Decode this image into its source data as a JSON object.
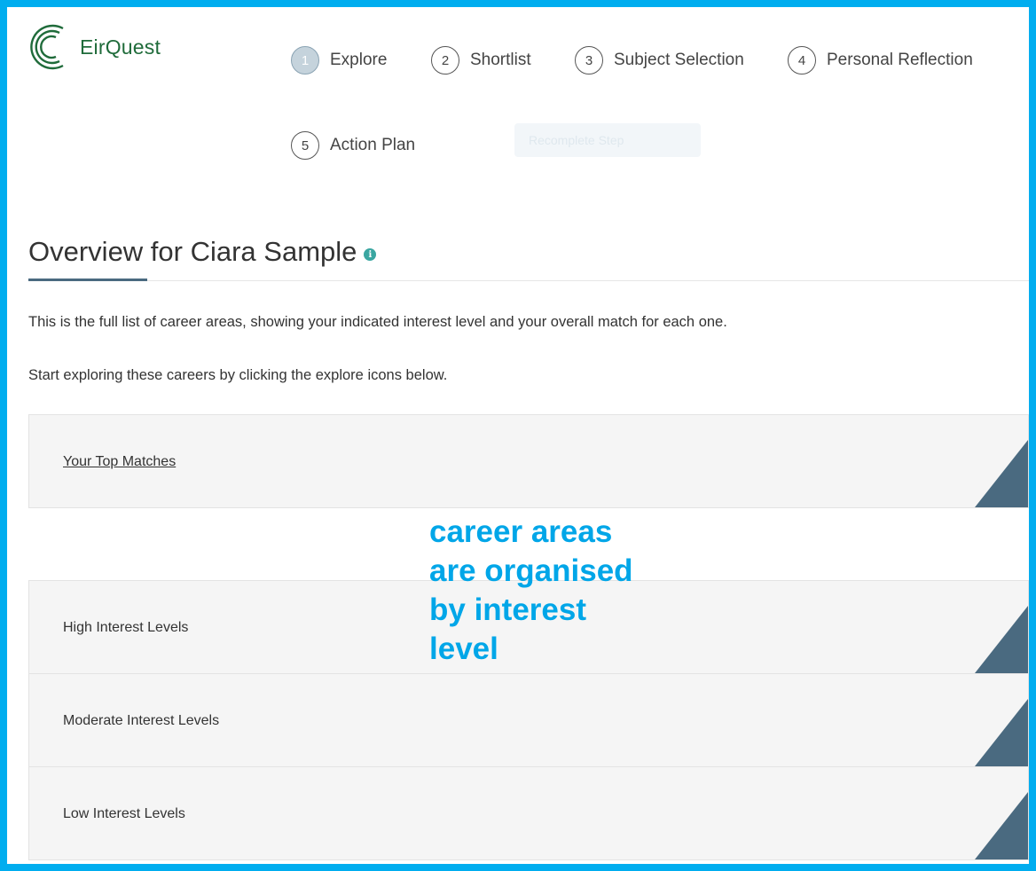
{
  "brand": {
    "name": "EirQuest",
    "color": "#1f6b3a"
  },
  "steps": [
    {
      "number": "1",
      "label": "Explore",
      "active": true
    },
    {
      "number": "2",
      "label": "Shortlist"
    },
    {
      "number": "3",
      "label": "Subject Selection"
    },
    {
      "number": "4",
      "label": "Personal Reflection"
    },
    {
      "number": "5",
      "label": "Action Plan"
    }
  ],
  "restart_button": {
    "label": "Recomplete Step"
  },
  "page": {
    "title": "Overview for Ciara Sample",
    "description": "This is the full list of career areas, showing your indicated interest level and your overall match for each one.",
    "instruction": "Start exploring these careers by clicking the explore icons below."
  },
  "panels": [
    {
      "label": "Your Top Matches"
    },
    {
      "label": "High Interest Levels"
    },
    {
      "label": "Moderate Interest Levels"
    },
    {
      "label": "Low Interest Levels"
    }
  ],
  "annotation": {
    "lines": [
      "career areas",
      "are organised",
      "by interest",
      "level"
    ],
    "color": "#00a6e8"
  },
  "colors": {
    "border": "#00adef",
    "accent": "#4a6a80",
    "info": "#3aa6a1"
  }
}
